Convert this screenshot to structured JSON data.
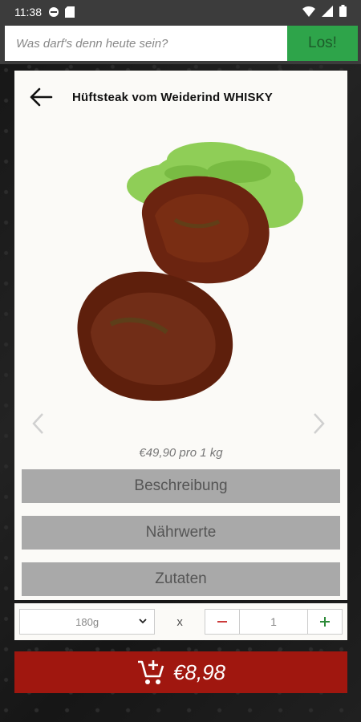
{
  "status": {
    "time": "11:38"
  },
  "search": {
    "placeholder": "Was darf's denn heute sein?",
    "button_label": "Los!"
  },
  "product": {
    "title": "Hüftsteak vom Weiderind WHISKY",
    "price_per_unit": "€49,90 pro 1 kg"
  },
  "sections": [
    {
      "label": "Beschreibung"
    },
    {
      "label": "Nährwerte"
    },
    {
      "label": "Zutaten"
    }
  ],
  "order": {
    "weight_selected": "180g",
    "times_symbol": "x",
    "quantity": "1",
    "cart_total": "€8,98"
  },
  "colors": {
    "accent_green": "#2ea44a",
    "cart_red": "#a0170f",
    "section_gray": "#a9a9a9"
  }
}
